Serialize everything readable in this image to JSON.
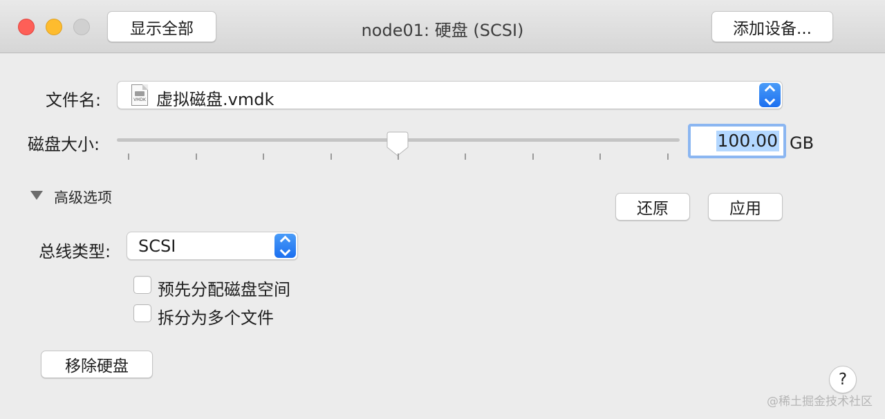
{
  "titlebar": {
    "window_title": "node01: 硬盘 (SCSI)",
    "show_all_label": "显示全部",
    "add_device_label": "添加设备..."
  },
  "file": {
    "label": "文件名:",
    "value": "虚拟磁盘.vmdk",
    "icon": "vmdk-file-icon",
    "icon_text": "VMDK"
  },
  "disk_size": {
    "label": "磁盘大小:",
    "value": "100.00",
    "unit": "GB",
    "slider_fraction": 0.5,
    "tick_count": 9
  },
  "advanced": {
    "label": "高级选项",
    "expanded": true,
    "revert_label": "还原",
    "apply_label": "应用",
    "bus_type_label": "总线类型:",
    "bus_type_value": "SCSI",
    "preallocate_label": "预先分配磁盘空间",
    "preallocate_checked": false,
    "split_label": "拆分为多个文件",
    "split_checked": false
  },
  "remove_label": "移除硬盘",
  "help_label": "?",
  "watermark": "@稀土掘金技术社区",
  "colors": {
    "accent": "#1b6ff0",
    "close": "#fe5f57",
    "minimize": "#febc2e",
    "selection": "#b3d7ff"
  }
}
